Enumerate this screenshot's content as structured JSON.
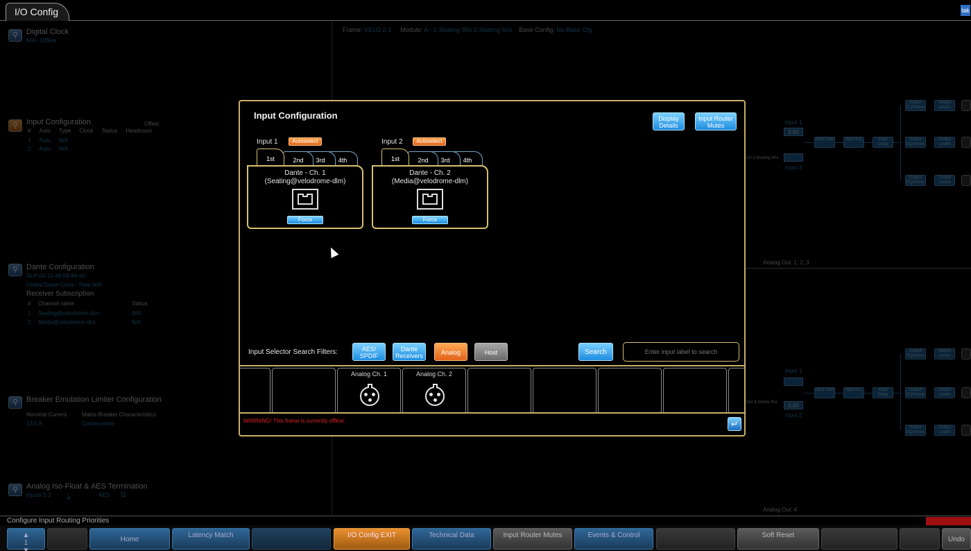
{
  "tab": {
    "label": "I/O Config"
  },
  "corner_icon": "lak",
  "frame_info": {
    "frame_label": "Frame:",
    "frame_value": "VELO 2-1",
    "module_label": "Module:",
    "module_value": "A - 1-Seating 95x 2-Seating 60x",
    "base_label": "Base Config:",
    "base_value": "No Base Cfg"
  },
  "left_panel": {
    "digital_clock": {
      "title": "Digital Clock",
      "sub": "N/A - Offline"
    },
    "input_config": {
      "title": "Input Configuration",
      "offset_header": "Offset",
      "headers": [
        "#",
        "Auto",
        "Type",
        "Clock",
        "Status",
        "Headroom"
      ],
      "rows": [
        [
          "1",
          "Auto",
          "N/A"
        ],
        [
          "2",
          "Auto",
          "N/A"
        ]
      ]
    },
    "dante_config": {
      "title": "Dante Configuration",
      "mac": "DLP-00-12-a6-09-84-e0",
      "global_clock": "Global Dante Clock - Rate N/A",
      "subscription_title": "Receiver Subscription",
      "headers": [
        "#",
        "Channel name",
        "Status"
      ],
      "rows": [
        [
          "1",
          "Seating@velodrome-dlm",
          "N/A"
        ],
        [
          "2",
          "Media@velodrome-dlm",
          "N/A"
        ]
      ]
    },
    "breaker": {
      "title": "Breaker Emulation Limiter Configuration",
      "col1": "Nominal Current",
      "col2": "Mains Breaker Characteristics",
      "val1": "13.0 A",
      "val2": "Conservative"
    },
    "analog_iso": {
      "title": "Analog Iso-Float & AES Termination",
      "inputs": "Inputs 1-2",
      "aes": "AES"
    }
  },
  "right_panel": {
    "input1": "Input 1",
    "input2": "Input 2",
    "value1": "0.00",
    "input_gain": "Input Gain",
    "input_eq": "Input EQ",
    "input_delay": "Input Delay",
    "output_eq": "Output EQ/Xover",
    "output_levels": "Output Levels",
    "analog_out_a": "Analog Out: 1, 2, 3",
    "analog_out_b": "Analog Out: 4",
    "seating_label": "Ch 2-Seating 60x",
    "media_label": "60x & Media 95x"
  },
  "modal": {
    "title": "Input Configuration",
    "display_details": "Display Details",
    "input_router_mutes": "Input Router Mutes",
    "inputs": [
      {
        "label": "Input 1",
        "autoselect": "Autoselect",
        "tabs": [
          "1st",
          "2nd",
          "3rd",
          "4th"
        ],
        "source_line1": "Dante - Ch. 1",
        "source_line2": "(Seating@velodrome-dlm)",
        "force": "Force"
      },
      {
        "label": "Input 2",
        "autoselect": "Autoselect",
        "tabs": [
          "1st",
          "2nd",
          "3rd",
          "4th"
        ],
        "source_line1": "Dante - Ch. 2",
        "source_line2": "(Media@velodrome-dlm)",
        "force": "Force"
      }
    ],
    "filters_label": "Input Selector Search Filters:",
    "filters": {
      "aes": "AES/ SPDIF",
      "dante": "Dante Receivers",
      "analog": "Analog",
      "host": "Host"
    },
    "search_button": "Search",
    "search_placeholder": "Enter input label to search",
    "cells": [
      "",
      "",
      "Analog Ch. 1",
      "Analog Ch. 2",
      "",
      "",
      "",
      "",
      ""
    ],
    "warning": "WARNING! This frame is currently offline."
  },
  "status_line": "Configure Input Routing Priorities",
  "fkeys": {
    "home": "Home",
    "latency": "Latency Match",
    "io_exit": "I/O Config EXIT",
    "technical": "Technical Data",
    "router_mutes": "Input Router Mutes",
    "events": "Events & Control",
    "soft_reset": "Soft Reset",
    "undo": "Undo"
  },
  "colors": {
    "accent_gold": "#c8b068",
    "button_blue": "#1d8ce0",
    "autoselect_orange": "#e2621a",
    "warning_red": "#e02020"
  }
}
